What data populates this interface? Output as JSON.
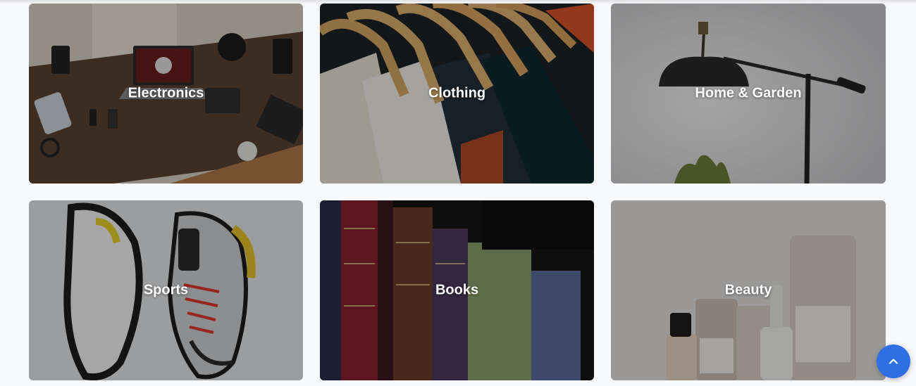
{
  "categories": [
    {
      "label": "Electronics",
      "image": "desk-with-laptop-and-gadgets"
    },
    {
      "label": "Clothing",
      "image": "shirts-on-wooden-hangers"
    },
    {
      "label": "Home & Garden",
      "image": "black-desk-lamp"
    },
    {
      "label": "Sports",
      "image": "running-sneakers"
    },
    {
      "label": "Books",
      "image": "old-book-spines"
    },
    {
      "label": "Beauty",
      "image": "skincare-bottles"
    }
  ],
  "scroll_top": {
    "icon": "chevron-up-icon",
    "color": "#2f6fe4"
  }
}
